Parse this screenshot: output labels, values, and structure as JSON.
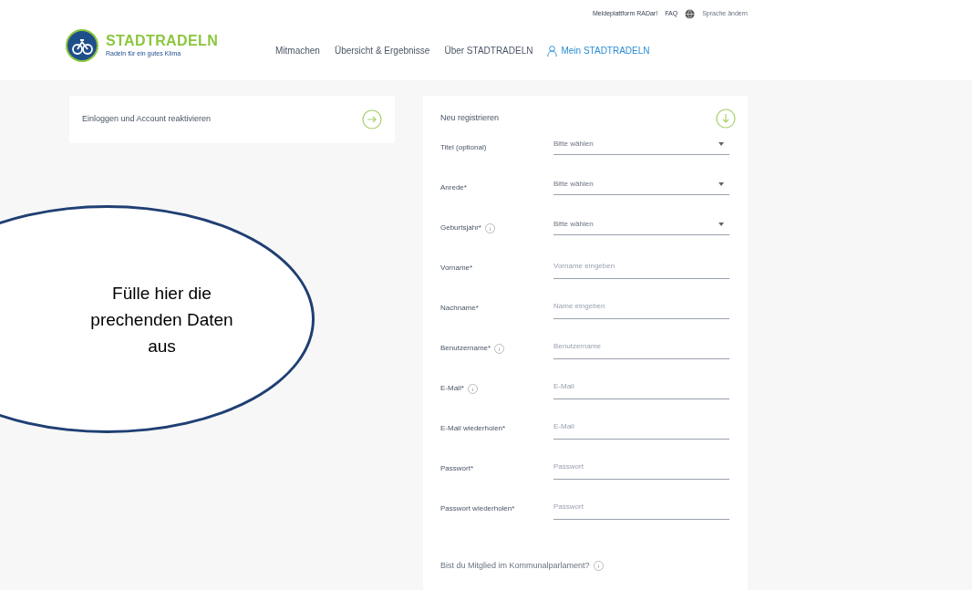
{
  "top_links": [
    {
      "kind": "link",
      "label": "Meldeplattform RADar!"
    },
    {
      "kind": "link",
      "label": "FAQ"
    },
    {
      "kind": "language",
      "label": "Sprache ändern"
    }
  ],
  "logo": {
    "title": "STADTRADELN",
    "tagline": "Radeln für ein gutes Klima"
  },
  "nav": [
    {
      "label": "Mitmachen",
      "selected": false,
      "user_icon": false
    },
    {
      "label": "Übersicht & Ergebnisse",
      "selected": false,
      "user_icon": false
    },
    {
      "label": "Über STADTRADELN",
      "selected": false,
      "user_icon": false
    },
    {
      "label": "Mein STADTRADELN",
      "selected": true,
      "user_icon": true
    }
  ],
  "login_panel": {
    "title": "Einloggen und Account reaktivieren"
  },
  "register_panel": {
    "title": "Neu registrieren",
    "fields": [
      {
        "kind": "select",
        "label": "Titel (optional)",
        "info": false,
        "placeholder": "Bitte wählen"
      },
      {
        "kind": "select",
        "label": "Anrede*",
        "info": false,
        "placeholder": "Bitte wählen"
      },
      {
        "kind": "select",
        "label": "Geburtsjahr*",
        "info": true,
        "placeholder": "Bitte wählen"
      },
      {
        "kind": "input",
        "label": "Vorname*",
        "info": false,
        "placeholder": "Vorname eingeben"
      },
      {
        "kind": "input",
        "label": "Nachname*",
        "info": false,
        "placeholder": "Name eingeben"
      },
      {
        "kind": "input",
        "label": "Benutzername*",
        "info": true,
        "placeholder": "Benutzername"
      },
      {
        "kind": "input",
        "label": "E-Mail*",
        "info": true,
        "placeholder": "E-Mail"
      },
      {
        "kind": "input",
        "label": "E-Mail wiederholen*",
        "info": false,
        "placeholder": "E-Mail"
      },
      {
        "kind": "input",
        "label": "Passwort*",
        "info": false,
        "placeholder": "Passwort"
      },
      {
        "kind": "input",
        "label": "Passwort wiederholen*",
        "info": false,
        "placeholder": "Passwort"
      }
    ],
    "question": "Bist du Mitglied im Kommunalparlament?"
  },
  "callout": {
    "lines": [
      "Fülle hier die",
      "prechenden Daten",
      "aus"
    ]
  }
}
